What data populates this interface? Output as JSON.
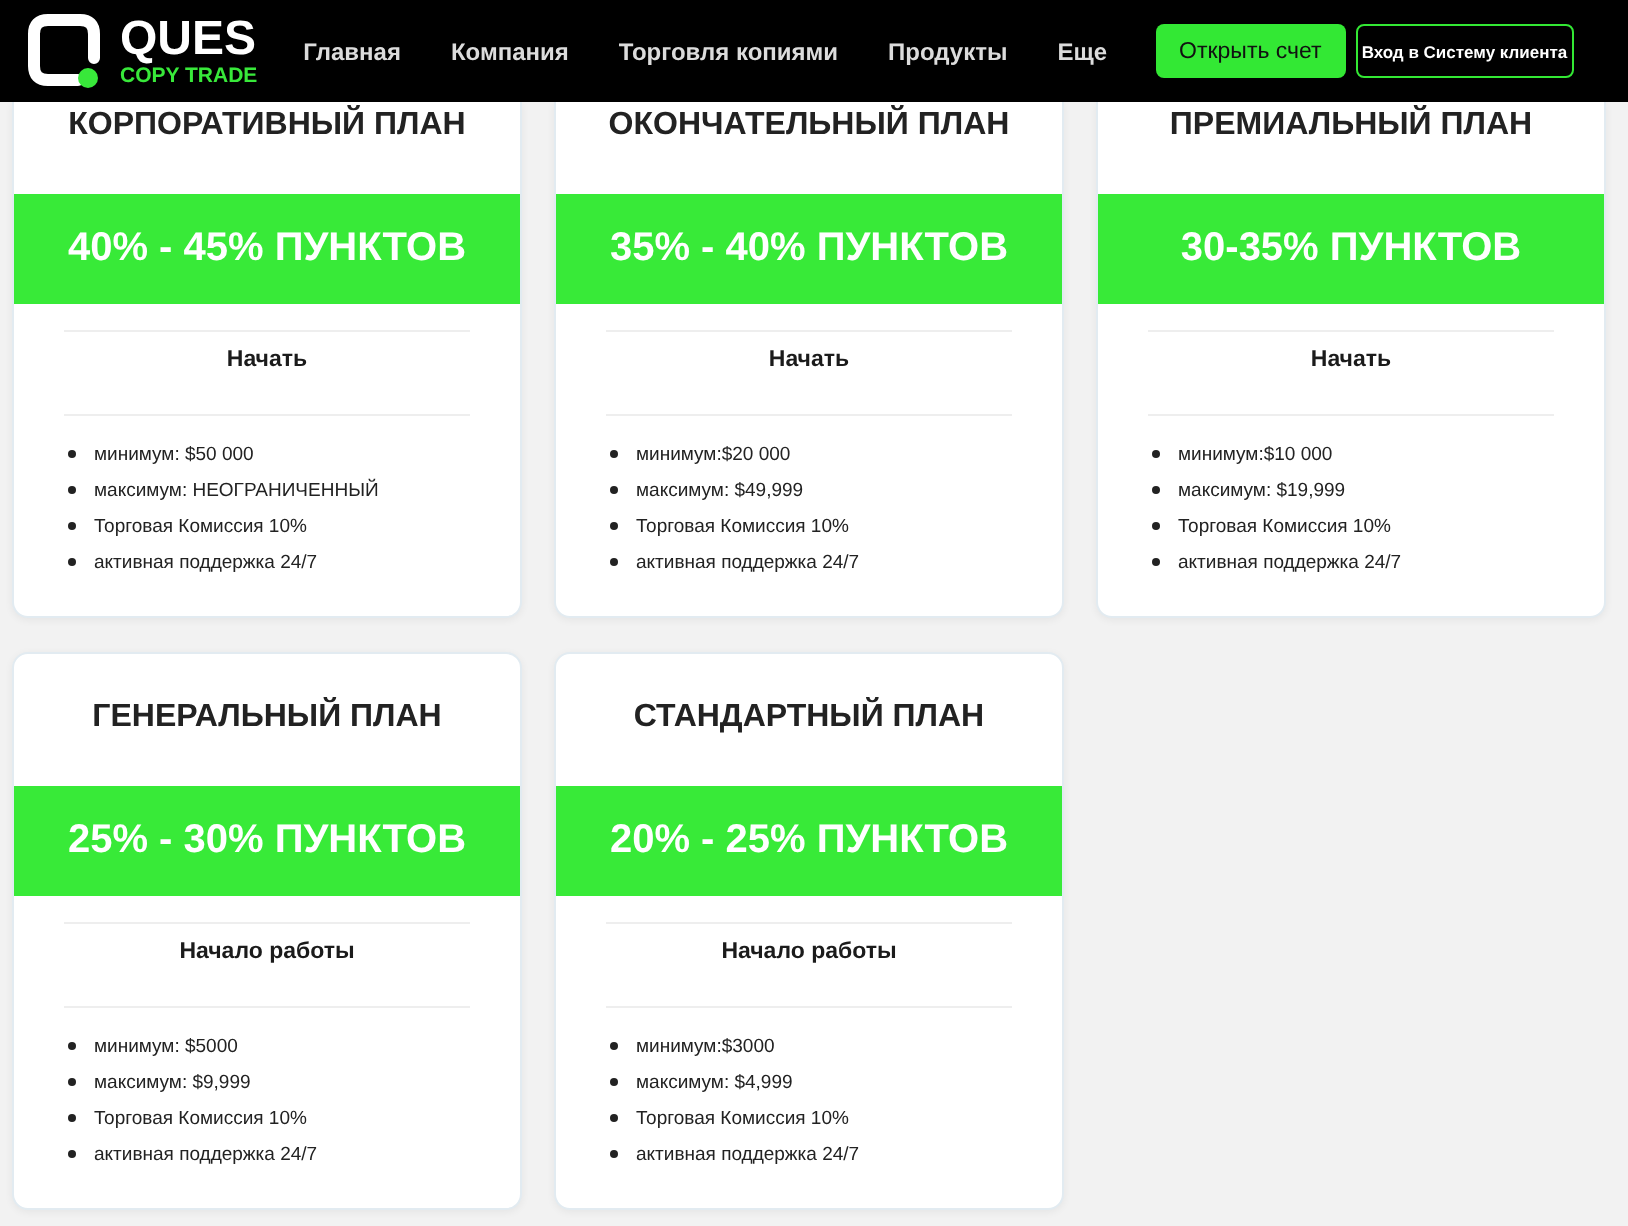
{
  "header": {
    "logo": {
      "name": "QUES",
      "tagline": "COPY TRADE"
    },
    "nav": [
      "Главная",
      "Компания",
      "Торговля копиями",
      "Продукты",
      "Еще"
    ],
    "buttons": [
      {
        "label": "Открыть счет",
        "kind": "primary"
      },
      {
        "label": "Вход в Систему клиента",
        "kind": "outline"
      }
    ]
  },
  "plans": [
    {
      "title": "КОРПОРАТИВНЫЙ ПЛАН",
      "points": "40% - 45% ПУНКТОВ",
      "action": "Начать",
      "features": [
        "минимум: $50 000",
        "максимум: НЕОГРАНИЧЕННЫЙ",
        "Торговая Комиссия 10%",
        "активная поддержка 24/7"
      ]
    },
    {
      "title": "ОКОНЧАТЕЛЬНЫЙ ПЛАН",
      "points": "35% - 40% ПУНКТОВ",
      "action": "Начать",
      "features": [
        "минимум:$20 000",
        "максимум: $49,999",
        "Торговая Комиссия 10%",
        "активная поддержка 24/7"
      ]
    },
    {
      "title": "ПРЕМИАЛЬНЫЙ ПЛАН",
      "points": "30-35% ПУНКТОВ",
      "action": "Начать",
      "features": [
        "минимум:$10 000",
        "максимум: $19,999",
        "Торговая Комиссия 10%",
        "активная поддержка 24/7"
      ]
    },
    {
      "title": "ГЕНЕРАЛЬНЫЙ ПЛАН",
      "points": "25% - 30% ПУНКТОВ",
      "action": "Начало работы",
      "features": [
        "минимум: $5000",
        "максимум: $9,999",
        "Торговая Комиссия 10%",
        "активная поддержка 24/7"
      ]
    },
    {
      "title": "СТАНДАРТНЫЙ ПЛАН",
      "points": "20% - 25% ПУНКТОВ",
      "action": "Начало работы",
      "features": [
        "минимум:$3000",
        "максимум: $4,999",
        "Торговая Комиссия 10%",
        "активная поддержка 24/7"
      ]
    }
  ]
}
